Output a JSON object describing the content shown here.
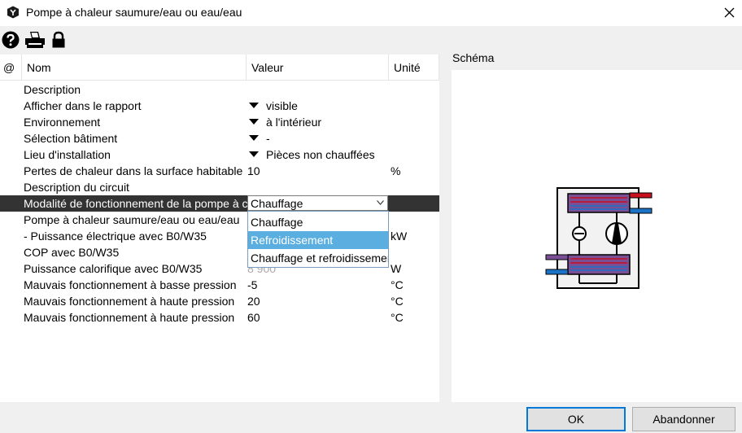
{
  "window": {
    "title": "Pompe à chaleur saumure/eau ou eau/eau"
  },
  "toolbar": {
    "icons": [
      "help-icon",
      "print-icon",
      "lock-icon"
    ]
  },
  "grid": {
    "headers": {
      "at": "@",
      "name": "Nom",
      "value": "Valeur",
      "unit": "Unité"
    },
    "rows": [
      {
        "name": "Description",
        "value": "",
        "unit": ""
      },
      {
        "name": "Afficher dans le rapport",
        "value": "visible",
        "unit": ""
      },
      {
        "name": "Environnement",
        "value": "à l'intérieur",
        "unit": ""
      },
      {
        "name": "Sélection bâtiment",
        "value": "-",
        "unit": ""
      },
      {
        "name": "Lieu d'installation",
        "value": "Pièces non chauffées",
        "unit": ""
      },
      {
        "name": "Pertes de chaleur dans la surface habitable",
        "value": "10",
        "unit": "%"
      },
      {
        "name": "Description du circuit",
        "value": "",
        "unit": ""
      },
      {
        "name": "Modalité de fonctionnement de la pompe à chaleur",
        "value": "Chauffage",
        "unit": ""
      },
      {
        "name": "Pompe à chaleur saumure/eau ou eau/eau",
        "value": "",
        "unit": ""
      },
      {
        "name": "- Puissance électrique avec B0/W35",
        "value": "",
        "unit": "kW"
      },
      {
        "name": "COP avec B0/W35",
        "value": "",
        "unit": ""
      },
      {
        "name": "Puissance calorifique avec B0/W35",
        "value": "8 900",
        "unit": "W"
      },
      {
        "name": "Mauvais fonctionnement à basse pression",
        "value": "-5",
        "unit": "°C"
      },
      {
        "name": "Mauvais fonctionnement à haute pression",
        "value": "20",
        "unit": "°C"
      },
      {
        "name": "Mauvais fonctionnement à haute pression",
        "value": "60",
        "unit": "°C"
      }
    ],
    "dropdown_options": [
      "Chauffage",
      "Refroidissement",
      "Chauffage et refroidissement"
    ],
    "dropdown_highlighted": "Refroidissement"
  },
  "schema": {
    "label": "Schéma",
    "colors": {
      "hot": "#c8101e",
      "cold": "#1b73c7",
      "exchanger": "#7b4f96",
      "body": "#f2f2f2"
    }
  },
  "buttons": {
    "ok": "OK",
    "cancel": "Abandonner"
  }
}
